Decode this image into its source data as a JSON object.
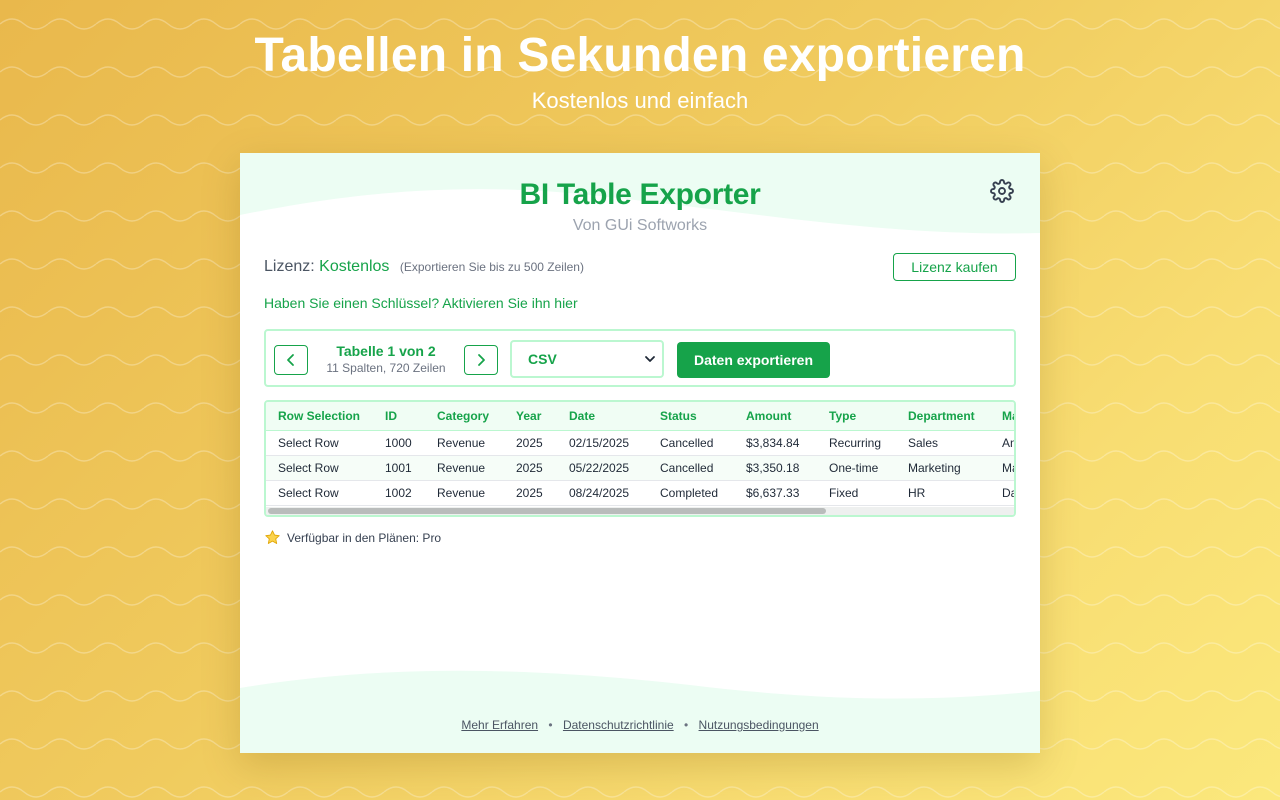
{
  "promo": {
    "title": "Tabellen in Sekunden exportieren",
    "subtitle": "Kostenlos und einfach"
  },
  "app": {
    "title": "BI Table Exporter",
    "byline": "Von GUi Softworks",
    "settings_icon": "gear-icon"
  },
  "license": {
    "label": "Lizenz:",
    "value": "Kostenlos",
    "note": "(Exportieren Sie bis zu 500 Zeilen)",
    "buy_button": "Lizenz kaufen",
    "activate_link": "Haben Sie einen Schlüssel? Aktivieren Sie ihn hier"
  },
  "toolbar": {
    "prev_icon": "chevron-left-icon",
    "next_icon": "chevron-right-icon",
    "table_counter": "Tabelle 1 von 2",
    "table_dims": "11 Spalten, 720 Zeilen",
    "format_selected": "CSV",
    "export_button": "Daten exportieren"
  },
  "table": {
    "columns": [
      "Row Selection",
      "ID",
      "Category",
      "Year",
      "Date",
      "Status",
      "Amount",
      "Type",
      "Department",
      "Ma"
    ],
    "rows": [
      [
        "Select Row",
        "1000",
        "Revenue",
        "2025",
        "02/15/2025",
        "Cancelled",
        "$3,834.84",
        "Recurring",
        "Sales",
        "An"
      ],
      [
        "Select Row",
        "1001",
        "Revenue",
        "2025",
        "05/22/2025",
        "Cancelled",
        "$3,350.18",
        "One-time",
        "Marketing",
        "Ma"
      ],
      [
        "Select Row",
        "1002",
        "Revenue",
        "2025",
        "08/24/2025",
        "Completed",
        "$6,637.33",
        "Fixed",
        "HR",
        "Da"
      ]
    ],
    "scroll_fraction": 0.75
  },
  "plans_note": {
    "icon": "star-icon",
    "text": "Verfügbar in den Plänen: Pro"
  },
  "footer": {
    "link_1": "Mehr Erfahren",
    "link_2": "Datenschutzrichtlinie",
    "link_3": "Nutzungsbedingungen",
    "separator": "•"
  },
  "colors": {
    "accent": "#16a34a",
    "accent_light": "#bbf7d0",
    "background_start": "#e9b84c",
    "background_end": "#fbe87c"
  }
}
